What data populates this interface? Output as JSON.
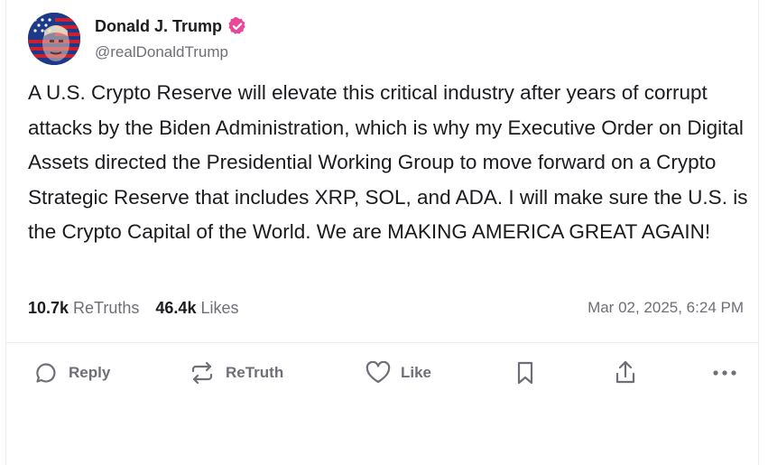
{
  "author": {
    "display_name": "Donald J. Trump",
    "handle": "@realDonaldTrump",
    "verified": true,
    "verified_color": "#e8479a"
  },
  "post": {
    "text": "A U.S. Crypto Reserve will elevate this critical industry after years of corrupt attacks by the Biden Administration, which is why my Executive Order on Digital Assets directed the Presidential Working Group to move forward on a Crypto Strategic Reserve that includes XRP, SOL, and ADA. I will make sure the U.S. is the Crypto Capital of the World. We are MAKING AMERICA GREAT AGAIN!",
    "timestamp": "Mar 02, 2025, 6:24 PM"
  },
  "stats": {
    "retruths_count": "10.7k",
    "retruths_label": "ReTruths",
    "likes_count": "46.4k",
    "likes_label": "Likes"
  },
  "actions": {
    "reply_label": "Reply",
    "retruth_label": "ReTruth",
    "like_label": "Like",
    "icons": [
      "reply-icon",
      "retruth-icon",
      "like-icon",
      "bookmark-icon",
      "share-icon",
      "more-icon"
    ]
  }
}
